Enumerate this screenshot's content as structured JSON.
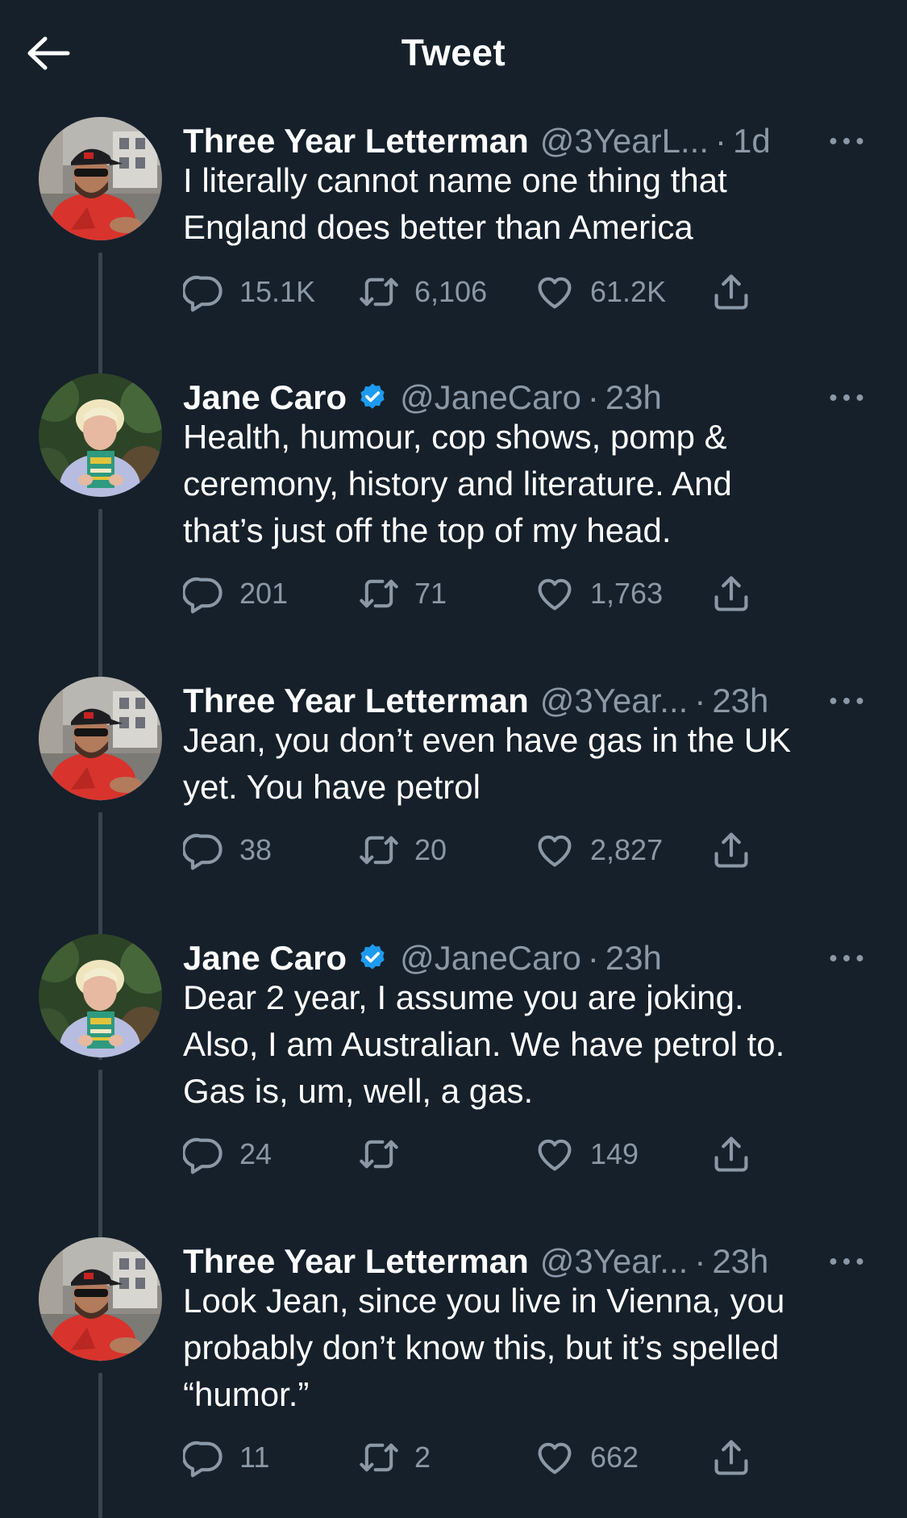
{
  "header": {
    "title": "Tweet"
  },
  "tweets": [
    {
      "author": "Three Year Letterman",
      "handle": "@3YearL...",
      "time": "1d",
      "verified": false,
      "text": "I literally cannot name one thing that\nEngland does better than America",
      "replies": "15.1K",
      "retweets": "6,106",
      "likes": "61.2K"
    },
    {
      "author": "Jane Caro",
      "handle": "@JaneCaro",
      "time": "23h",
      "verified": true,
      "text": "Health, humour, cop shows, pomp &\nceremony, history and literature. And\nthat’s just off the top of my head.",
      "replies": "201",
      "retweets": "71",
      "likes": "1,763"
    },
    {
      "author": "Three Year Letterman",
      "handle": "@3Year...",
      "time": "23h",
      "verified": false,
      "text": "Jean, you don’t even have gas in the UK\nyet. You have petrol",
      "replies": "38",
      "retweets": "20",
      "likes": "2,827"
    },
    {
      "author": "Jane Caro",
      "handle": "@JaneCaro",
      "time": "23h",
      "verified": true,
      "text": "Dear 2 year, I assume you are joking.\nAlso, I am Australian. We have petrol to.\nGas is, um, well, a gas.",
      "replies": "24",
      "retweets": "",
      "likes": "149"
    },
    {
      "author": "Three Year Letterman",
      "handle": "@3Year...",
      "time": "23h",
      "verified": false,
      "text": "Look Jean, since you live in Vienna, you\nprobably don’t know this, but it’s spelled\n“humor.”",
      "replies": "11",
      "retweets": "2",
      "likes": "662"
    }
  ],
  "separator": "·",
  "colors": {
    "background": "#15202b",
    "muted": "#8b98a5",
    "verified": "#1d9bf0",
    "thread_line": "#38444d"
  },
  "icons": [
    "back-arrow-icon",
    "verified-badge-icon",
    "more-icon",
    "reply-icon",
    "retweet-icon",
    "like-icon",
    "share-icon"
  ]
}
